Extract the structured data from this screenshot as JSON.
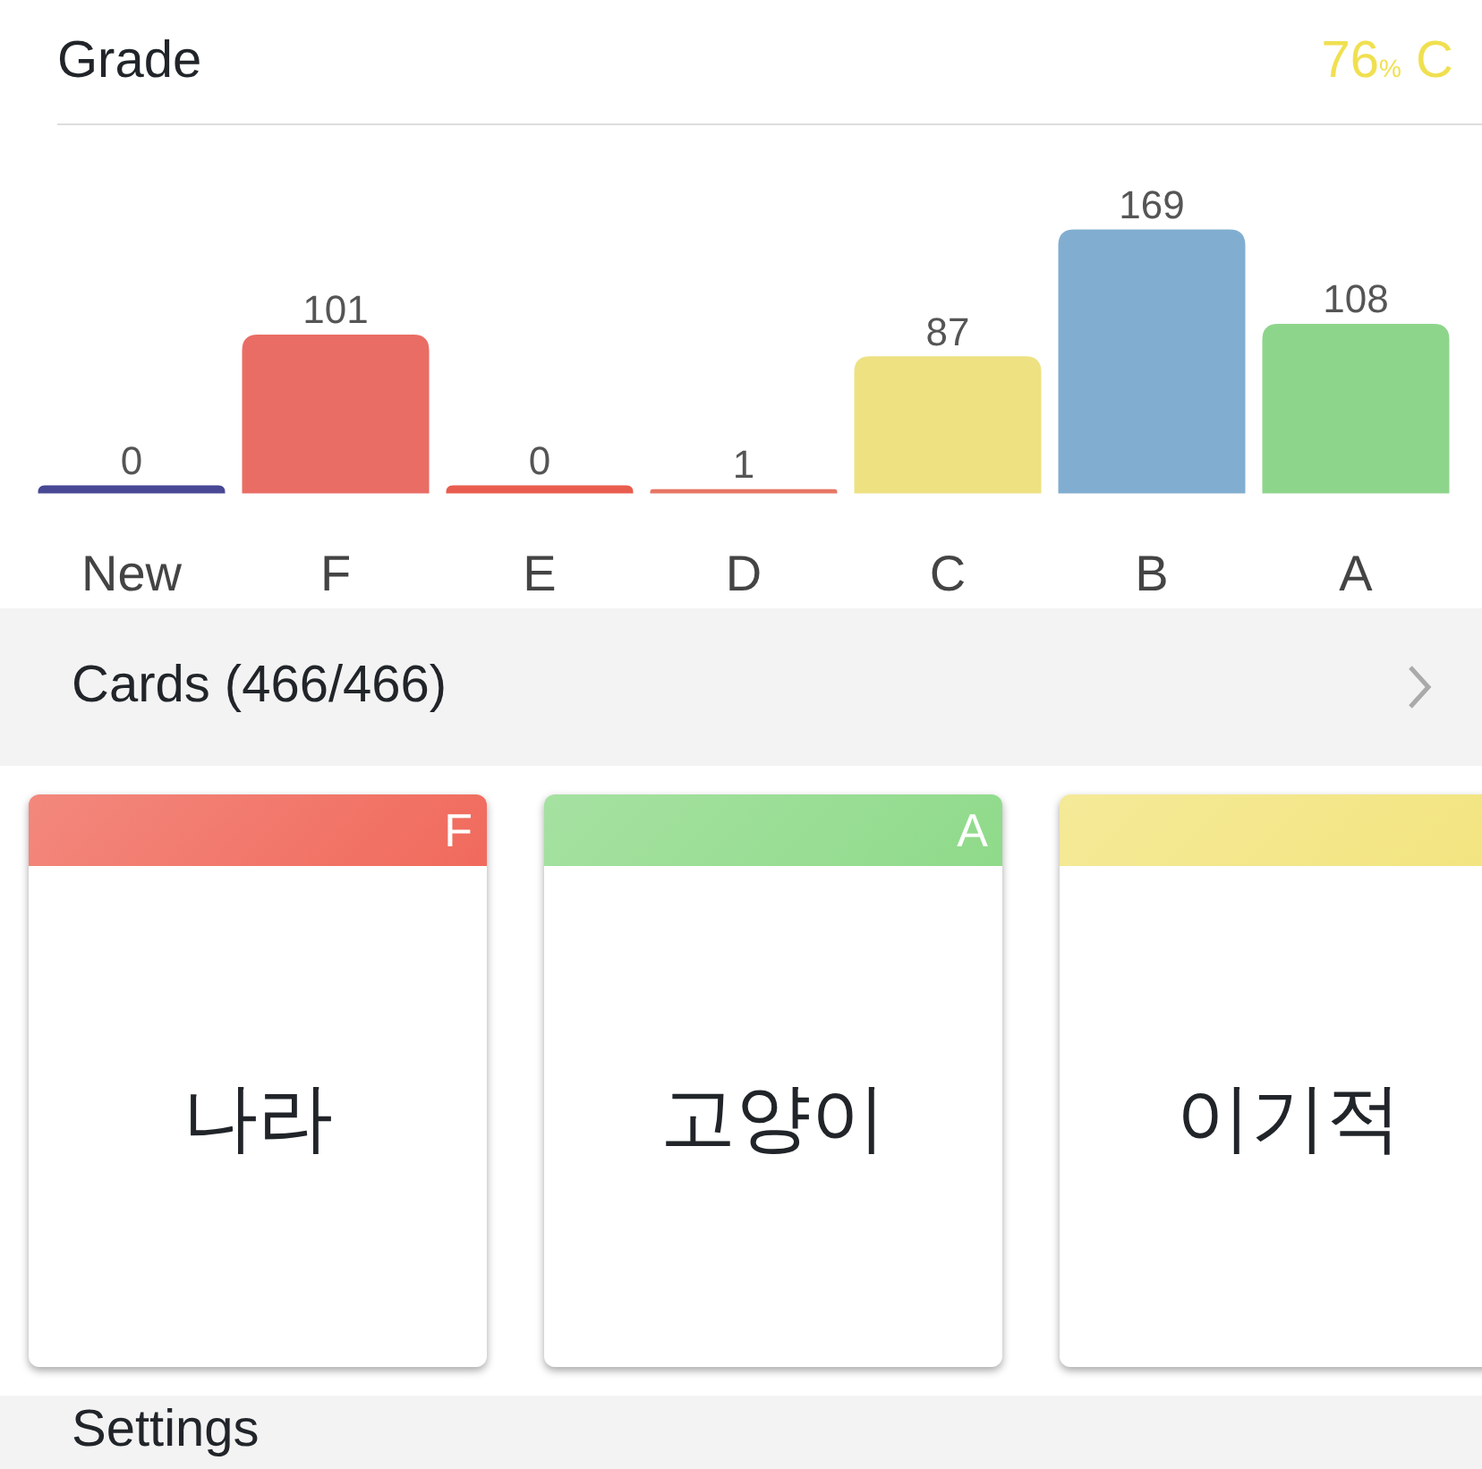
{
  "grade": {
    "label": "Grade",
    "score": "76",
    "unit": "%",
    "letter": "C",
    "color": "#f0e050"
  },
  "chart_data": {
    "type": "bar",
    "categories": [
      "New",
      "F",
      "E",
      "D",
      "C",
      "B",
      "A"
    ],
    "values": [
      0,
      101,
      0,
      1,
      87,
      169,
      108
    ],
    "colors": [
      "#4a4a9a",
      "#f07068",
      "#f06050",
      "#ee7a68",
      "#f5e886",
      "#85b3d6",
      "#92dc90"
    ],
    "data_labels": true
  },
  "cards_section": {
    "title": "Cards (466/466)"
  },
  "cards": [
    {
      "grade": "F",
      "color": "#f06a5c",
      "word": "나라"
    },
    {
      "grade": "A",
      "color": "#8fda8a",
      "word": "고양이"
    },
    {
      "color": "#f2e47e",
      "word": "이기적"
    }
  ],
  "settings_section": {
    "title": "Settings"
  }
}
